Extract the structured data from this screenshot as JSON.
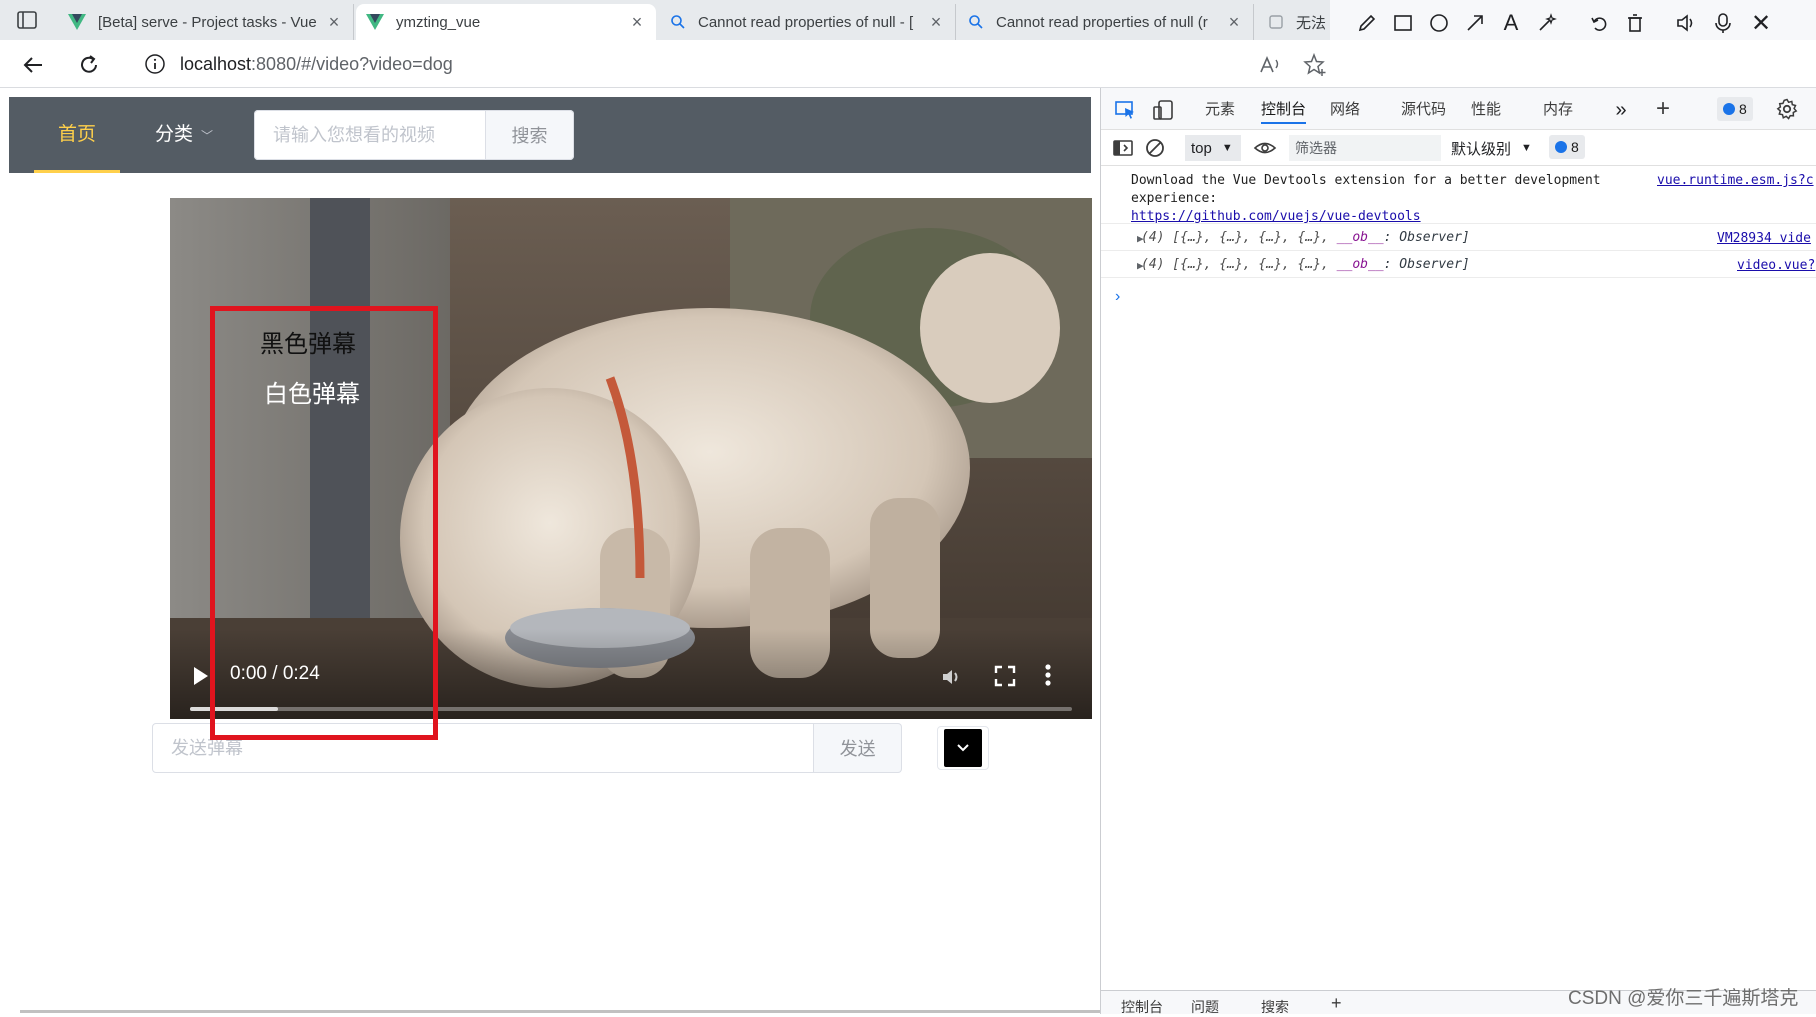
{
  "browser": {
    "tabs": [
      {
        "title": "[Beta] serve - Project tasks - Vue",
        "favicon": "vue-icon"
      },
      {
        "title": "ymzting_vue",
        "favicon": "vue-icon",
        "active": true
      },
      {
        "title": "Cannot read properties of null - [",
        "favicon": "search-icon"
      },
      {
        "title": "Cannot read properties of null (r",
        "favicon": "search-icon"
      },
      {
        "title": "无法",
        "favicon": "page-icon"
      }
    ],
    "address": {
      "host": "localhost",
      "path": ":8080/#/video?video=dog"
    }
  },
  "site": {
    "menu": {
      "home": "首页",
      "category": "分类"
    },
    "search": {
      "placeholder": "请输入您想看的视频",
      "button": "搜索"
    },
    "video": {
      "danmaku": [
        {
          "text": "黑色弹幕",
          "color": "#111111"
        },
        {
          "text": "白色弹幕",
          "color": "#ffffff"
        }
      ],
      "time": "0:00 / 0:24",
      "buffered_fraction": 0.1
    },
    "danmaku_form": {
      "placeholder": "发送弹幕",
      "button": "发送",
      "color": "#000000"
    },
    "highlight_color": "#e0141e"
  },
  "devtools": {
    "tabs": [
      "元素",
      "控制台",
      "网络",
      "源代码",
      "性能",
      "内存"
    ],
    "active_tab": "控制台",
    "message_count": "8",
    "toolbar": {
      "context": "top",
      "filter_placeholder": "筛选器",
      "level": "默认级别",
      "issue_count": "8"
    },
    "console": {
      "msg1_text": "Download the Vue Devtools extension for a better development experience:",
      "msg1_link": "https://github.com/vuejs/vue-devtools",
      "msg1_src": "vue.runtime.esm.js?c",
      "obj1_prefix": "(4) [{…}, {…}, {…}, {…}, ",
      "obj1_src": "VM28934 vide",
      "obj2_prefix": "(4) [{…}, {…}, {…}, {…}, ",
      "obj2_src": "video.vue?",
      "ob_key": "__ob__",
      "ob_value": ": Observer]"
    },
    "drawer_tabs": [
      "控制台",
      "问题",
      "搜索"
    ]
  },
  "watermark": "CSDN @爱你三千遍斯塔克"
}
